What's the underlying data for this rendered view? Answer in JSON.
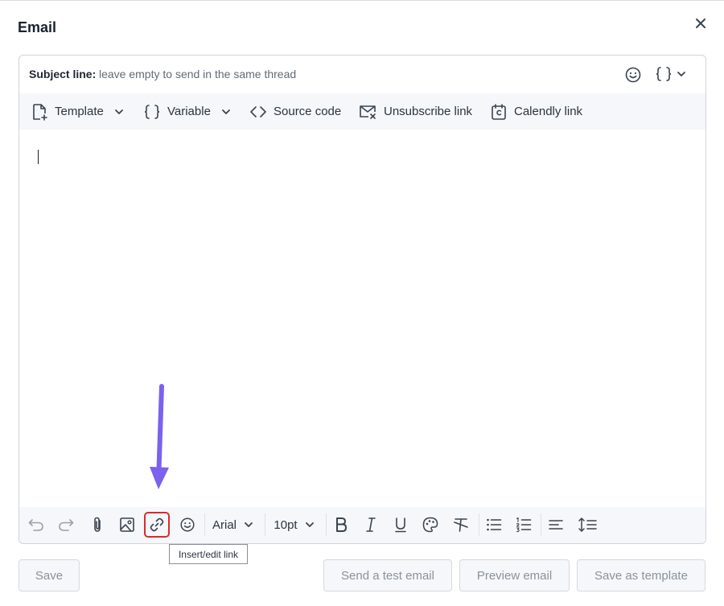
{
  "dialog": {
    "title": "Email",
    "close_label": "×"
  },
  "subject": {
    "label": "Subject line:",
    "value": "",
    "placeholder": "leave empty to send in the same thread"
  },
  "top_toolbar": {
    "template_label": "Template",
    "variable_label": "Variable",
    "source_code_label": "Source code",
    "unsubscribe_label": "Unsubscribe link",
    "calendly_label": "Calendly link"
  },
  "editor_body": {
    "text": ""
  },
  "bottom_toolbar": {
    "font_family": "Arial",
    "font_size": "10pt",
    "tooltip": "Insert/edit link"
  },
  "footer": {
    "save_label": "Save",
    "send_test_label": "Send a test email",
    "preview_label": "Preview email",
    "save_template_label": "Save as template"
  },
  "colors": {
    "highlight_box": "#e0282e",
    "annotation_arrow": "#7b61ee",
    "toolbar_bg": "#f5f7fa"
  },
  "icons": [
    "close-icon",
    "smiley-icon",
    "braces-icon",
    "chevron-down-icon",
    "template-doc-icon",
    "code-icon",
    "mail-x-icon",
    "calendar-c-icon",
    "undo-icon",
    "redo-icon",
    "paperclip-icon",
    "image-icon",
    "link-icon",
    "bold-icon",
    "italic-icon",
    "underline-icon",
    "palette-icon",
    "clear-format-icon",
    "bullet-list-icon",
    "numbered-list-icon",
    "align-icon",
    "line-height-icon",
    "arrow-down-annotation"
  ]
}
